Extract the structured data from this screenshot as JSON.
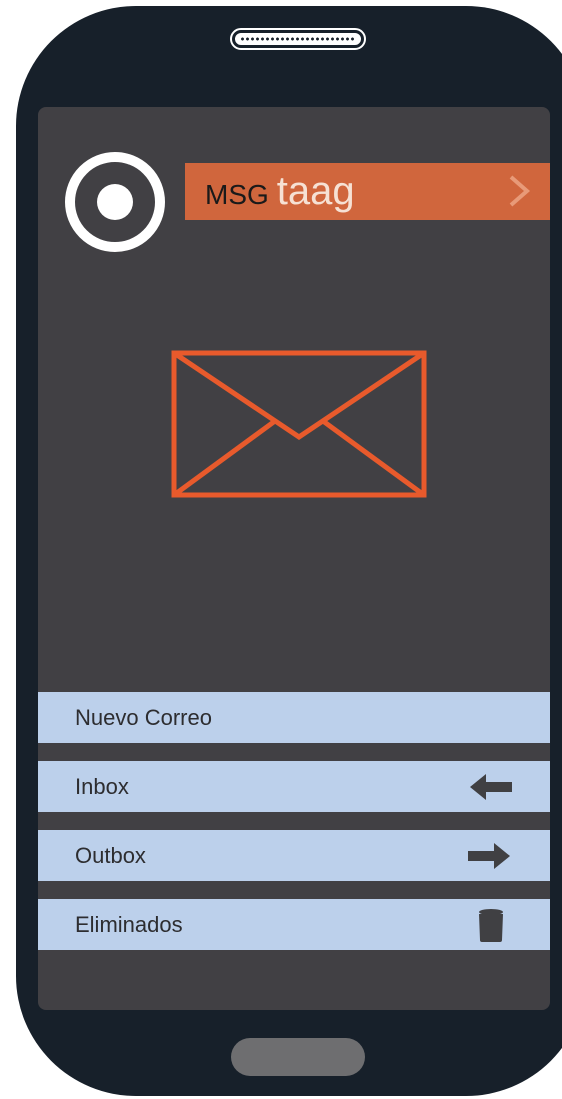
{
  "brand": {
    "primary": "MSG",
    "secondary": "taag",
    "color": "#d0663d"
  },
  "hero_icon": "envelope-icon",
  "menu": {
    "items": [
      {
        "label": "Nuevo Correo",
        "icon": null
      },
      {
        "label": "Inbox",
        "icon": "arrow-left-icon"
      },
      {
        "label": "Outbox",
        "icon": "arrow-right-icon"
      },
      {
        "label": "Eliminados",
        "icon": "trash-icon"
      }
    ],
    "background": "#bcd0eb"
  },
  "colors": {
    "screen": "#414044",
    "frame": "#17202a",
    "accent": "#e85a2c"
  }
}
